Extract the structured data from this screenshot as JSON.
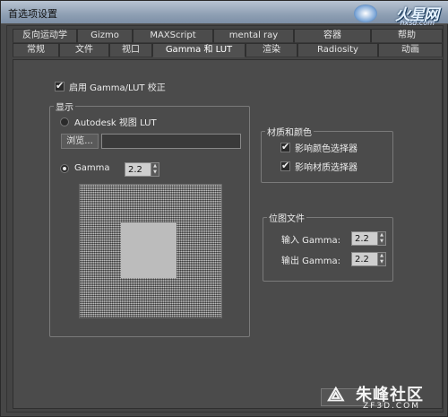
{
  "window": {
    "title": "首选项设置"
  },
  "watermark_top": {
    "brand": "火星网",
    "url": "hxsd.com"
  },
  "tabs_row1": [
    "反向运动学",
    "Gizmo",
    "MAXScript",
    "mental ray",
    "容器",
    "帮助"
  ],
  "tabs_row2": [
    "常规",
    "文件",
    "视口",
    "Gamma 和 LUT",
    "渲染",
    "Radiosity",
    "动画"
  ],
  "active_tab": "Gamma 和 LUT",
  "enable_gamma": {
    "label": "启用 Gamma/LUT 校正",
    "checked": true
  },
  "display_group": {
    "label": "显示",
    "lut_option": {
      "label": "Autodesk 视图 LUT",
      "selected": false
    },
    "browse_button": "浏览...",
    "lut_path": "",
    "gamma_option": {
      "label": "Gamma",
      "selected": true
    },
    "gamma_value": "2.2"
  },
  "material_group": {
    "label": "材质和颜色",
    "affect_color_picker": {
      "label": "影响颜色选择器",
      "checked": true
    },
    "affect_material_picker": {
      "label": "影响材质选择器",
      "checked": true
    }
  },
  "bitmap_group": {
    "label": "位图文件",
    "input_gamma": {
      "label": "输入 Gamma:",
      "value": "2.2"
    },
    "output_gamma": {
      "label": "输出 Gamma:",
      "value": "2.2"
    }
  },
  "watermark_bottom": {
    "brand": "朱峰社区",
    "url": "ZF3D.COM"
  }
}
